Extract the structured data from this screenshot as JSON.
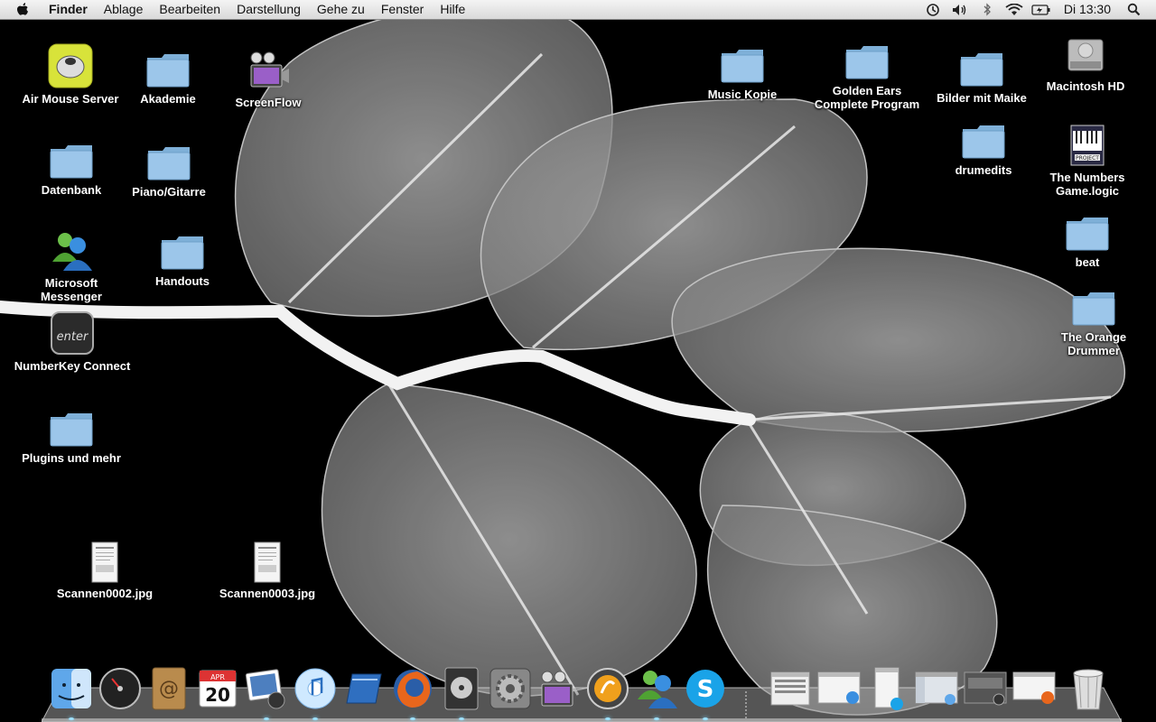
{
  "menubar": {
    "app_name": "Finder",
    "menus": [
      "Ablage",
      "Bearbeiten",
      "Darstellung",
      "Gehe zu",
      "Fenster",
      "Hilfe"
    ],
    "status_icons": [
      "time-machine-icon",
      "volume-icon",
      "bluetooth-icon",
      "wifi-icon",
      "battery-icon"
    ],
    "clock": "Di 13:30",
    "spotlight_icon": "spotlight-icon"
  },
  "desktop": {
    "left_icons": [
      {
        "label": "Air Mouse Server",
        "icon": "air-mouse-app-icon"
      },
      {
        "label": "Akademie",
        "icon": "folder-icon"
      },
      {
        "label": "ScreenFlow",
        "icon": "screenflow-app-icon"
      },
      {
        "label": "Datenbank",
        "icon": "folder-icon"
      },
      {
        "label": "Piano/Gitarre",
        "icon": "folder-icon"
      },
      {
        "label": "Microsoft Messenger",
        "icon": "messenger-app-icon"
      },
      {
        "label": "Handouts",
        "icon": "folder-icon"
      },
      {
        "label": "NumberKey Connect",
        "icon": "numberkey-app-icon"
      },
      {
        "label": "Plugins und mehr",
        "icon": "folder-icon"
      },
      {
        "label": "Scannen0002.jpg",
        "icon": "jpg-document-icon"
      },
      {
        "label": "Scannen0003.jpg",
        "icon": "jpg-document-icon"
      }
    ],
    "right_icons": [
      {
        "label": "Music Kopie",
        "icon": "folder-icon"
      },
      {
        "label": "Golden Ears\nComplete Program",
        "icon": "folder-icon"
      },
      {
        "label": "Bilder mit Maike",
        "icon": "folder-icon"
      },
      {
        "label": "Macintosh HD",
        "icon": "hard-drive-icon"
      },
      {
        "label": "drumedits",
        "icon": "folder-icon"
      },
      {
        "label": "The Numbers\nGame.logic",
        "icon": "logic-project-icon"
      },
      {
        "label": "beat",
        "icon": "folder-icon"
      },
      {
        "label": "The Orange Drummer",
        "icon": "folder-icon"
      }
    ]
  },
  "dock": {
    "calendar_month": "APR",
    "calendar_day": "20",
    "apps": [
      {
        "name": "finder-dock-icon",
        "running": true
      },
      {
        "name": "dashboard-dock-icon",
        "running": false
      },
      {
        "name": "address-book-dock-icon",
        "running": false
      },
      {
        "name": "ical-dock-icon",
        "running": false
      },
      {
        "name": "iphoto-dock-icon",
        "running": true
      },
      {
        "name": "itunes-dock-icon",
        "running": true
      },
      {
        "name": "word-dock-icon",
        "running": false
      },
      {
        "name": "firefox-dock-icon",
        "running": true
      },
      {
        "name": "dvd-player-dock-icon",
        "running": true
      },
      {
        "name": "system-preferences-dock-icon",
        "running": false
      },
      {
        "name": "screenflow-dock-icon",
        "running": false
      },
      {
        "name": "logic-dock-icon",
        "running": true
      },
      {
        "name": "messenger-dock-icon",
        "running": true
      },
      {
        "name": "skype-dock-icon",
        "running": true
      }
    ],
    "minimized_windows": [
      {
        "name": "minimized-window-1-icon"
      },
      {
        "name": "minimized-window-messenger-icon"
      },
      {
        "name": "minimized-window-skype-icon"
      },
      {
        "name": "minimized-window-itunes-icon"
      },
      {
        "name": "minimized-window-dvd-icon"
      },
      {
        "name": "minimized-window-firefox-icon"
      }
    ],
    "trash": "trash-icon"
  }
}
